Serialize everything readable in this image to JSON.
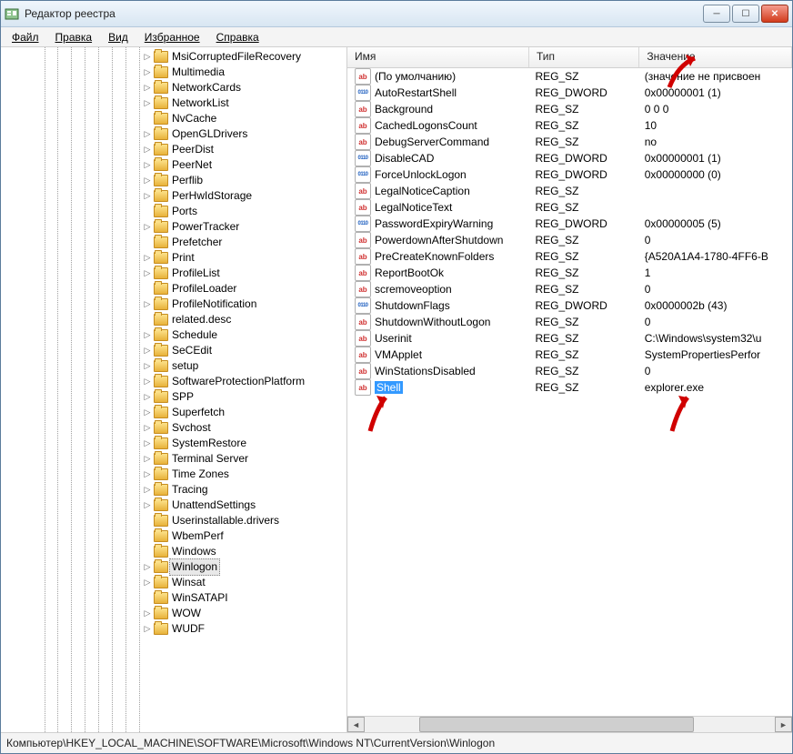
{
  "title": "Редактор реестра",
  "menu": [
    "Файл",
    "Правка",
    "Вид",
    "Избранное",
    "Справка"
  ],
  "statusbar": "Компьютер\\HKEY_LOCAL_MACHINE\\SOFTWARE\\Microsoft\\Windows NT\\CurrentVersion\\Winlogon",
  "tree": [
    {
      "name": "MsiCorruptedFileRecovery",
      "expandable": true
    },
    {
      "name": "Multimedia",
      "expandable": true
    },
    {
      "name": "NetworkCards",
      "expandable": true
    },
    {
      "name": "NetworkList",
      "expandable": true
    },
    {
      "name": "NvCache",
      "expandable": false
    },
    {
      "name": "OpenGLDrivers",
      "expandable": true
    },
    {
      "name": "PeerDist",
      "expandable": true
    },
    {
      "name": "PeerNet",
      "expandable": true
    },
    {
      "name": "Perflib",
      "expandable": true
    },
    {
      "name": "PerHwIdStorage",
      "expandable": true
    },
    {
      "name": "Ports",
      "expandable": false
    },
    {
      "name": "PowerTracker",
      "expandable": true
    },
    {
      "name": "Prefetcher",
      "expandable": false
    },
    {
      "name": "Print",
      "expandable": true
    },
    {
      "name": "ProfileList",
      "expandable": true
    },
    {
      "name": "ProfileLoader",
      "expandable": false
    },
    {
      "name": "ProfileNotification",
      "expandable": true
    },
    {
      "name": "related.desc",
      "expandable": false
    },
    {
      "name": "Schedule",
      "expandable": true
    },
    {
      "name": "SeCEdit",
      "expandable": true
    },
    {
      "name": "setup",
      "expandable": true
    },
    {
      "name": "SoftwareProtectionPlatform",
      "expandable": true
    },
    {
      "name": "SPP",
      "expandable": true
    },
    {
      "name": "Superfetch",
      "expandable": true
    },
    {
      "name": "Svchost",
      "expandable": true
    },
    {
      "name": "SystemRestore",
      "expandable": true
    },
    {
      "name": "Terminal Server",
      "expandable": true
    },
    {
      "name": "Time Zones",
      "expandable": true
    },
    {
      "name": "Tracing",
      "expandable": true
    },
    {
      "name": "UnattendSettings",
      "expandable": true
    },
    {
      "name": "Userinstallable.drivers",
      "expandable": false
    },
    {
      "name": "WbemPerf",
      "expandable": false
    },
    {
      "name": "Windows",
      "expandable": false
    },
    {
      "name": "Winlogon",
      "expandable": true,
      "selected": true
    },
    {
      "name": "Winsat",
      "expandable": true
    },
    {
      "name": "WinSATAPI",
      "expandable": false
    },
    {
      "name": "WOW",
      "expandable": true
    },
    {
      "name": "WUDF",
      "expandable": true
    }
  ],
  "columns": {
    "name": "Имя",
    "type": "Тип",
    "value": "Значение"
  },
  "col_widths": {
    "name": 215,
    "type": 130,
    "value": 180
  },
  "rows": [
    {
      "icon": "ab",
      "name": "(По умолчанию)",
      "type": "REG_SZ",
      "value": "(значение не присвоен"
    },
    {
      "icon": "bin",
      "name": "AutoRestartShell",
      "type": "REG_DWORD",
      "value": "0x00000001 (1)"
    },
    {
      "icon": "ab",
      "name": "Background",
      "type": "REG_SZ",
      "value": "0 0 0"
    },
    {
      "icon": "ab",
      "name": "CachedLogonsCount",
      "type": "REG_SZ",
      "value": "10"
    },
    {
      "icon": "ab",
      "name": "DebugServerCommand",
      "type": "REG_SZ",
      "value": "no"
    },
    {
      "icon": "bin",
      "name": "DisableCAD",
      "type": "REG_DWORD",
      "value": "0x00000001 (1)"
    },
    {
      "icon": "bin",
      "name": "ForceUnlockLogon",
      "type": "REG_DWORD",
      "value": "0x00000000 (0)"
    },
    {
      "icon": "ab",
      "name": "LegalNoticeCaption",
      "type": "REG_SZ",
      "value": ""
    },
    {
      "icon": "ab",
      "name": "LegalNoticeText",
      "type": "REG_SZ",
      "value": ""
    },
    {
      "icon": "bin",
      "name": "PasswordExpiryWarning",
      "type": "REG_DWORD",
      "value": "0x00000005 (5)"
    },
    {
      "icon": "ab",
      "name": "PowerdownAfterShutdown",
      "type": "REG_SZ",
      "value": "0"
    },
    {
      "icon": "ab",
      "name": "PreCreateKnownFolders",
      "type": "REG_SZ",
      "value": "{A520A1A4-1780-4FF6-B"
    },
    {
      "icon": "ab",
      "name": "ReportBootOk",
      "type": "REG_SZ",
      "value": "1"
    },
    {
      "icon": "ab",
      "name": "scremoveoption",
      "type": "REG_SZ",
      "value": "0"
    },
    {
      "icon": "bin",
      "name": "ShutdownFlags",
      "type": "REG_DWORD",
      "value": "0x0000002b (43)"
    },
    {
      "icon": "ab",
      "name": "ShutdownWithoutLogon",
      "type": "REG_SZ",
      "value": "0"
    },
    {
      "icon": "ab",
      "name": "Userinit",
      "type": "REG_SZ",
      "value": "C:\\Windows\\system32\\u"
    },
    {
      "icon": "ab",
      "name": "VMApplet",
      "type": "REG_SZ",
      "value": "SystemPropertiesPerfor"
    },
    {
      "icon": "ab",
      "name": "WinStationsDisabled",
      "type": "REG_SZ",
      "value": "0"
    },
    {
      "icon": "ab",
      "name": "Shell",
      "type": "REG_SZ",
      "value": "explorer.exe",
      "selected": true
    }
  ]
}
